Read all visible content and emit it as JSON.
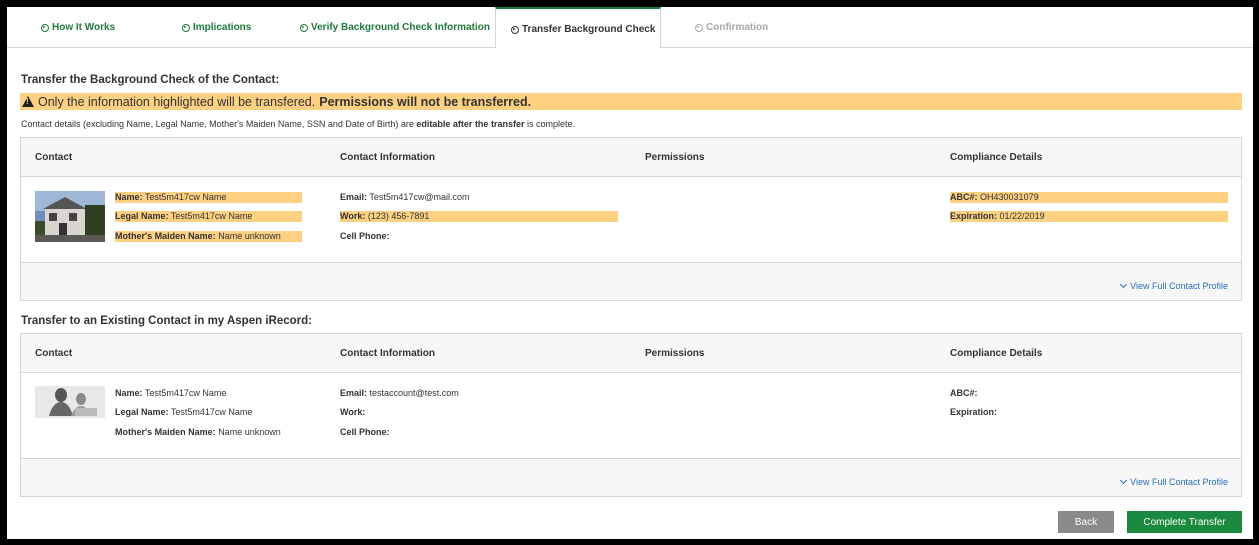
{
  "tabs": [
    {
      "label": "How It Works"
    },
    {
      "label": "Implications"
    },
    {
      "label": "Verify Background Check Information"
    },
    {
      "label": "Transfer Background Check"
    },
    {
      "label": "Confirmation"
    }
  ],
  "section1_title": "Transfer the Background Check of the Contact:",
  "warning": {
    "text": "Only the information highlighted will be transfered.",
    "bold": "Permissions will not be transferred."
  },
  "note": {
    "pre": "Contact details (excluding Name, Legal Name, Mother's Maiden Name, SSN and Date of Birth) are",
    "bold": "editable after the transfer",
    "post": "is complete."
  },
  "columns": [
    "Contact",
    "Contact Information",
    "Permissions",
    "Compliance Details"
  ],
  "source_contact": {
    "name_label": "Name:",
    "name": "Test5m417cw Name",
    "legal_label": "Legal Name:",
    "legal": "Test5m417cw Name",
    "maiden_label": "Mother's Maiden Name:",
    "maiden": "Name unknown",
    "email_label": "Email:",
    "email": "Test5m417cw@mail.com",
    "work_label": "Work:",
    "work": "(123) 456-7891",
    "cell_label": "Cell Phone:",
    "cell": "",
    "abc_label": "ABC#:",
    "abc": "OH430031079",
    "exp_label": "Expiration:",
    "exp": "01/22/2019"
  },
  "section2_title": "Transfer to an Existing Contact in my Aspen iRecord:",
  "target_contact": {
    "name_label": "Name:",
    "name": "Test5m417cw Name",
    "legal_label": "Legal Name:",
    "legal": "Test5m417cw Name",
    "maiden_label": "Mother's Maiden Name:",
    "maiden": "Name unknown",
    "email_label": "Email:",
    "email": "testaccount@test.com",
    "work_label": "Work:",
    "work": "",
    "cell_label": "Cell Phone:",
    "cell": "",
    "abc_label": "ABC#:",
    "abc": "",
    "exp_label": "Expiration:",
    "exp": ""
  },
  "view_profile_label": "View Full Contact Profile",
  "buttons": {
    "back": "Back",
    "complete": "Complete Transfer"
  },
  "colors": {
    "brand_green": "#1c8a3e",
    "highlight": "#fdd082",
    "link": "#2a6fb8"
  }
}
